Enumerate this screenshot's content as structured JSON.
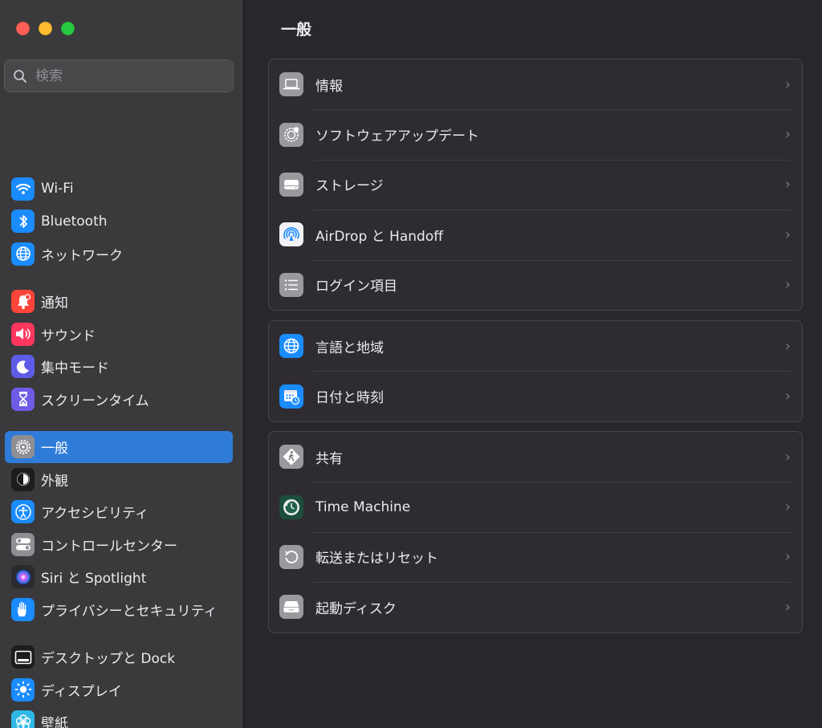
{
  "window": {
    "traffic_lights": {
      "close": "#ff5f57",
      "minimize": "#febc2e",
      "zoom": "#28c840"
    }
  },
  "search": {
    "placeholder": "検索",
    "value": ""
  },
  "sidebar": {
    "groups": [
      {
        "items": [
          {
            "label": "Wi-Fi",
            "icon": "wifi-icon",
            "color": "#1a8cff"
          },
          {
            "label": "Bluetooth",
            "icon": "bluetooth-icon",
            "color": "#1a8cff"
          },
          {
            "label": "ネットワーク",
            "icon": "globe-icon",
            "color": "#1a8cff"
          }
        ]
      },
      {
        "items": [
          {
            "label": "通知",
            "icon": "bell-icon",
            "color": "#ff453a"
          },
          {
            "label": "サウンド",
            "icon": "speaker-icon",
            "color": "#ff375f"
          },
          {
            "label": "集中モード",
            "icon": "moon-icon",
            "color": "#5e5ce6"
          },
          {
            "label": "スクリーンタイム",
            "icon": "hourglass-icon",
            "color": "#6e5ce6"
          }
        ]
      },
      {
        "items": [
          {
            "label": "一般",
            "icon": "gear-icon",
            "color": "#8e8e93",
            "selected": true
          },
          {
            "label": "外観",
            "icon": "appearance-icon",
            "color": "#1c1c1e"
          },
          {
            "label": "アクセシビリティ",
            "icon": "accessibility-icon",
            "color": "#1a8cff"
          },
          {
            "label": "コントロールセンター",
            "icon": "control-center-icon",
            "color": "#8e8e93"
          },
          {
            "label": "Siri と Spotlight",
            "icon": "siri-icon",
            "color": "#2b2b2e"
          },
          {
            "label": "プライバシーとセキュリティ",
            "icon": "hand-icon",
            "color": "#1a8cff"
          }
        ]
      },
      {
        "items": [
          {
            "label": "デスクトップと Dock",
            "icon": "dock-icon",
            "color": "#1c1c1e"
          },
          {
            "label": "ディスプレイ",
            "icon": "brightness-icon",
            "color": "#1a8cff"
          },
          {
            "label": "壁紙",
            "icon": "wallpaper-icon",
            "color": "#2fb8e6"
          }
        ]
      }
    ]
  },
  "main": {
    "title": "一般",
    "groups": [
      {
        "rows": [
          {
            "label": "情報",
            "icon": "laptop-icon"
          },
          {
            "label": "ソフトウェアアップデート",
            "icon": "software-update-icon"
          },
          {
            "label": "ストレージ",
            "icon": "storage-icon"
          },
          {
            "label": "AirDrop と Handoff",
            "icon": "airdrop-icon"
          },
          {
            "label": "ログイン項目",
            "icon": "list-icon"
          }
        ]
      },
      {
        "rows": [
          {
            "label": "言語と地域",
            "icon": "globe-icon"
          },
          {
            "label": "日付と時刻",
            "icon": "calendar-clock-icon"
          }
        ]
      },
      {
        "rows": [
          {
            "label": "共有",
            "icon": "sharing-icon"
          },
          {
            "label": "Time Machine",
            "icon": "time-machine-icon"
          },
          {
            "label": "転送またはリセット",
            "icon": "reset-icon"
          },
          {
            "label": "起動ディスク",
            "icon": "startup-disk-icon"
          }
        ]
      }
    ],
    "chevron": "›"
  }
}
